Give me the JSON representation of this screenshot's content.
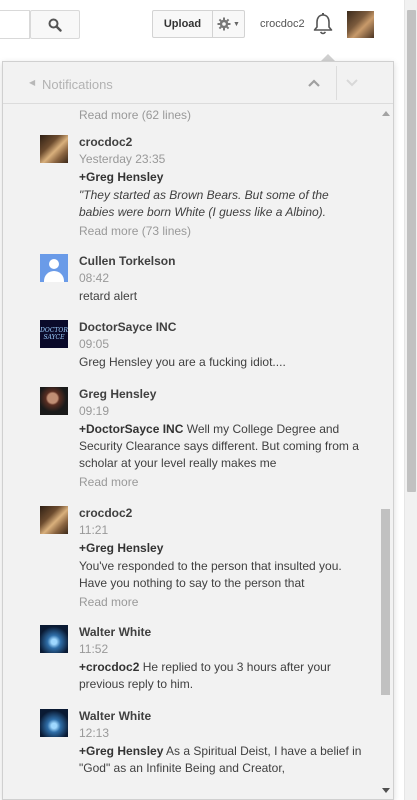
{
  "header": {
    "upload_label": "Upload",
    "username": "crocdoc2"
  },
  "panel": {
    "title": "Notifications",
    "top_read_more": "Read more (62 lines)"
  },
  "notifications": [
    {
      "author": "crocdoc2",
      "time": "Yesterday 23:35",
      "mention": "+Greg Hensley",
      "quote": "\"They started as Brown Bears. But some of the babies were born White (I guess like a Albino).",
      "read_more": "Read more (73 lines)"
    },
    {
      "author": "Cullen Torkelson",
      "time": "08:42",
      "text": "retard alert"
    },
    {
      "author": "DoctorSayce INC",
      "time": "09:05",
      "text": "Greg Hensley you are a fucking idiot....",
      "avatar_text": "DOCTOR SAYCE"
    },
    {
      "author": "Greg Hensley",
      "time": "09:19",
      "mention": "+DoctorSayce INC",
      "text": " Well my College Degree and Security Clearance says different. But coming from a scholar at your level really makes me",
      "read_more": "Read more"
    },
    {
      "author": "crocdoc2",
      "time": "11:21",
      "mention": "+Greg Hensley",
      "text": "You've responded to the person that insulted you. Have you nothing to say to the person that",
      "read_more": "Read more"
    },
    {
      "author": "Walter White",
      "time": "11:52",
      "mention": "+crocdoc2",
      "text": " He replied to you 3 hours after your previous reply to him."
    },
    {
      "author": "Walter White",
      "time": "12:13",
      "mention": "+Greg Hensley",
      "text": " As a Spiritual Deist, I have a belief in \"God\" as an Infinite Being and Creator,"
    }
  ]
}
